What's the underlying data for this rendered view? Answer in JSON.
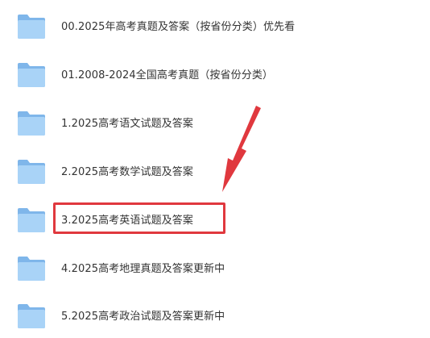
{
  "file_list": {
    "items": [
      {
        "name": "00.2025年高考真题及答案（按省份分类）优先看",
        "icon": "folder-icon"
      },
      {
        "name": "01.2008-2024全国高考真题（按省份分类）",
        "icon": "folder-icon"
      },
      {
        "name": "1.2025高考语文试题及答案",
        "icon": "folder-icon"
      },
      {
        "name": "2.2025高考数学试题及答案",
        "icon": "folder-icon"
      },
      {
        "name": "3.2025高考英语试题及答案",
        "icon": "folder-icon"
      },
      {
        "name": "4.2025高考地理真题及答案更新中",
        "icon": "folder-icon"
      },
      {
        "name": "5.2025高考政治试题及答案更新中",
        "icon": "folder-icon"
      }
    ]
  },
  "annotation": {
    "highlighted_item": "3.2025高考英语试题及答案",
    "color": "#e0383e"
  },
  "colors": {
    "folder_back": "#7fb6ea",
    "folder_front": "#a9d3f7",
    "text": "#333333"
  }
}
